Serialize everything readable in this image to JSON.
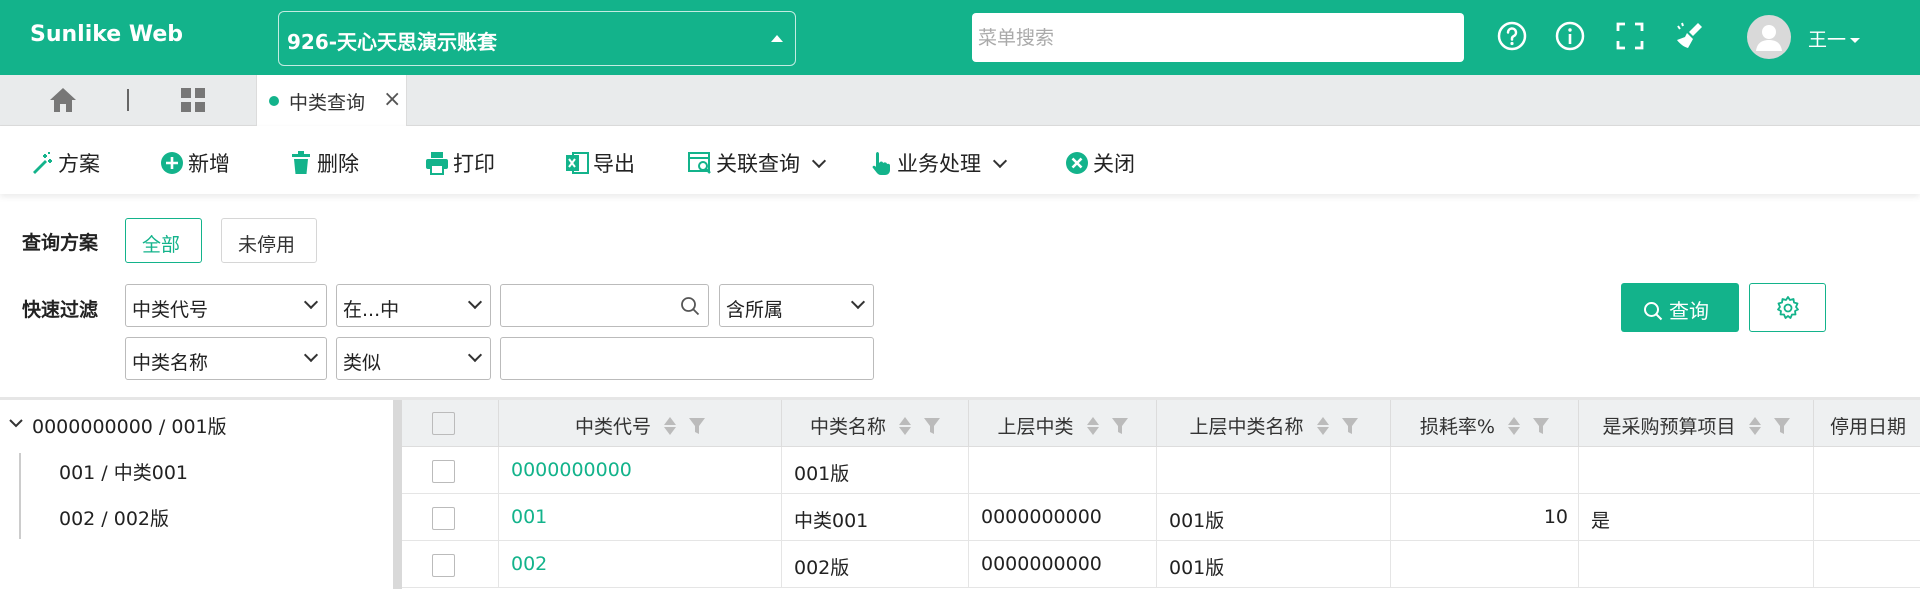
{
  "header": {
    "brand": "Sunlike Web",
    "account": "926-天心天思演示账套",
    "search_placeholder": "菜单搜索",
    "icons": [
      "help-circle-icon",
      "info-circle-icon",
      "fullscreen-icon",
      "clean-broom-icon"
    ],
    "user_name": "王一"
  },
  "tabs": {
    "active_label": "中类查询",
    "close_glyph": "×"
  },
  "toolbar": {
    "scheme": "方案",
    "add": "新增",
    "delete": "删除",
    "print": "打印",
    "export": "导出",
    "related_query": "关联查询",
    "business": "业务处理",
    "close": "关闭"
  },
  "filter": {
    "scheme_label": "查询方案",
    "scheme_all": "全部",
    "scheme_active": "未停用",
    "quick_label": "快速过滤",
    "row1": {
      "field": "中类代号",
      "operator": "在...中",
      "value": "",
      "option": "含所属"
    },
    "row2": {
      "field": "中类名称",
      "operator": "类似",
      "value": ""
    },
    "query_button": "查询"
  },
  "tree": {
    "root": "0000000000 / 001版",
    "children": [
      "001 / 中类001",
      "002 / 002版"
    ]
  },
  "grid": {
    "columns": [
      "中类代号",
      "中类名称",
      "上层中类",
      "上层中类名称",
      "损耗率%",
      "是采购预算项目",
      "停用日期"
    ],
    "rows": [
      {
        "code": "0000000000",
        "name": "001版",
        "parent": "",
        "parent_name": "",
        "loss": "",
        "budget": "",
        "stop": ""
      },
      {
        "code": "001",
        "name": "中类001",
        "parent": "0000000000",
        "parent_name": "001版",
        "loss": "10",
        "budget": "是",
        "stop": ""
      },
      {
        "code": "002",
        "name": "002版",
        "parent": "0000000000",
        "parent_name": "001版",
        "loss": "",
        "budget": "",
        "stop": ""
      }
    ]
  },
  "colors": {
    "brand": "#13b38b",
    "link": "#13b38b"
  }
}
